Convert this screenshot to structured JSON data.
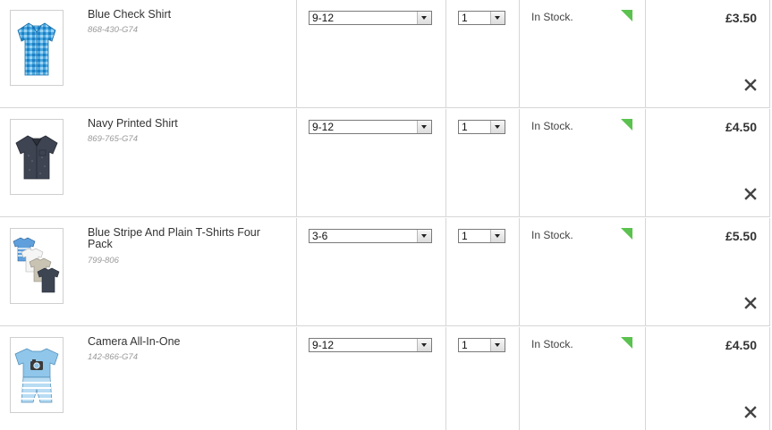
{
  "basket": {
    "items": [
      {
        "title": "Blue Check Shirt",
        "code": "868-430-G74",
        "size": "9-12",
        "quantity": "1",
        "stock": "In Stock.",
        "price": "£3.50",
        "image": "blue-check-shirt-thumbnail"
      },
      {
        "title": "Navy Printed Shirt",
        "code": "869-765-G74",
        "size": "9-12",
        "quantity": "1",
        "stock": "In Stock.",
        "price": "£4.50",
        "image": "navy-shirt-thumbnail"
      },
      {
        "title": "Blue Stripe And Plain T-Shirts Four Pack",
        "code": "799-806",
        "size": "3-6",
        "quantity": "1",
        "stock": "In Stock.",
        "price": "£5.50",
        "image": "tshirt-four-pack-thumbnail"
      },
      {
        "title": "Camera All-In-One",
        "code": "142-866-G74",
        "size": "9-12",
        "quantity": "1",
        "stock": "In Stock.",
        "price": "£4.50",
        "image": "camera-all-in-one-thumbnail"
      }
    ],
    "icons": {
      "stock": "stock-indicator-icon",
      "remove": "close-icon",
      "dropdown": "chevron-down-icon"
    },
    "colors": {
      "stock_indicator": "#5bc24f",
      "divider": "#d6d6d6"
    }
  }
}
